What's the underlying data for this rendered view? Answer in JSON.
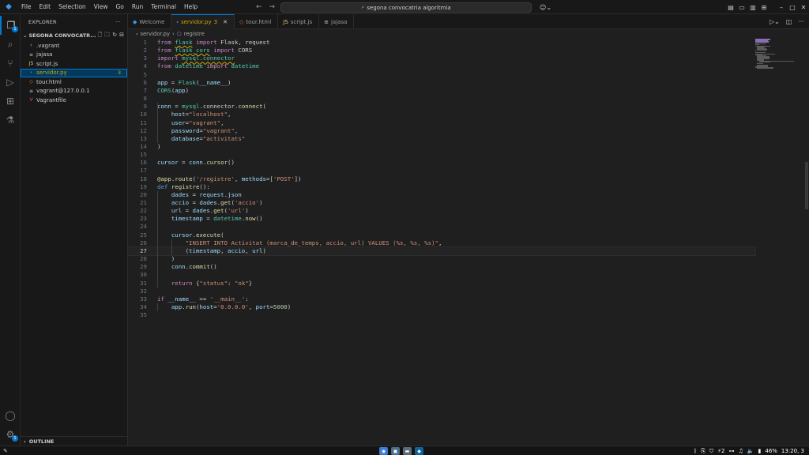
{
  "titlebar": {
    "menu": [
      "File",
      "Edit",
      "Selection",
      "View",
      "Go",
      "Run",
      "Terminal",
      "Help"
    ],
    "search_text": "segona convocatria algoritmia"
  },
  "activity": {
    "explorer_badge": "1",
    "settings_badge": "1"
  },
  "sidebar": {
    "header": "EXPLORER",
    "folder": "SEGONA CONVOCATR...",
    "files": [
      {
        "name": ".vagrant",
        "icon": "chevron-right-icon",
        "glyph": "›",
        "color": "#cccccc"
      },
      {
        "name": "jajasa",
        "icon": "file-icon",
        "glyph": "≡",
        "color": "#cccccc"
      },
      {
        "name": "script.js",
        "icon": "js-icon",
        "glyph": "JS",
        "color": "#e5c07b"
      },
      {
        "name": "servidor.py",
        "icon": "python-icon",
        "glyph": "⬩",
        "color": "#3b8ee0",
        "count": "3"
      },
      {
        "name": "tour.html",
        "icon": "html-icon",
        "glyph": "◇",
        "color": "#e37933"
      },
      {
        "name": "vagrant@127.0.0.1",
        "icon": "file-icon",
        "glyph": "≡",
        "color": "#cccccc"
      },
      {
        "name": "Vagrantfile",
        "icon": "vagrant-icon",
        "glyph": "V",
        "color": "#e05252"
      }
    ],
    "outline": "OUTLINE"
  },
  "tabs": [
    {
      "label": "Welcome",
      "icon": "vscode-icon",
      "glyph": "◆",
      "color": "#3b9be8"
    },
    {
      "label": "servidor.py",
      "icon": "python-icon",
      "glyph": "⬩",
      "color": "#3b8ee0",
      "modified": "3",
      "active": true
    },
    {
      "label": "tour.html",
      "icon": "html-icon",
      "glyph": "◇",
      "color": "#e37933"
    },
    {
      "label": "script.js",
      "icon": "js-icon",
      "glyph": "JS",
      "color": "#e5c07b"
    },
    {
      "label": "jajasa",
      "icon": "file-icon",
      "glyph": "≡",
      "color": "#cccccc"
    }
  ],
  "breadcrumb": {
    "file": "servidor.py",
    "symbol": "registre"
  },
  "editor": {
    "current_line": 27,
    "lines": [
      "[{\"t\":\"from\",\"c\":\"kw\"},{\"t\":\" \"},{\"t\":\"flask\",\"c\":\"mod2\"},{\"t\":\" \"},{\"t\":\"import\",\"c\":\"kw\"},{\"t\":\" Flask, request\"}]",
      "[{\"t\":\"from\",\"c\":\"kw\"},{\"t\":\" \"},{\"t\":\"flask_cors\",\"c\":\"mod2\"},{\"t\":\" \"},{\"t\":\"import\",\"c\":\"kw\"},{\"t\":\" CORS\"}]",
      "[{\"t\":\"import\",\"c\":\"kw\"},{\"t\":\" \"},{\"t\":\"mysql.connector\",\"c\":\"mod2\"}]",
      "[{\"t\":\"from\",\"c\":\"kw\"},{\"t\":\" \"},{\"t\":\"datetime\",\"c\":\"cls\"},{\"t\":\" \"},{\"t\":\"import\",\"c\":\"kw\"},{\"t\":\" \"},{\"t\":\"datetime\",\"c\":\"cls\"}]",
      "[]",
      "[{\"t\":\"app\",\"c\":\"var\"},{\"t\":\" = \"},{\"t\":\"Flask\",\"c\":\"cls\"},{\"t\":\"(\"},{\"t\":\"__name__\",\"c\":\"var\"},{\"t\":\")\"}]",
      "[{\"t\":\"CORS\",\"c\":\"cls\"},{\"t\":\"(\"},{\"t\":\"app\",\"c\":\"var\"},{\"t\":\")\"}]",
      "[]",
      "[{\"t\":\"conn\",\"c\":\"var\"},{\"t\":\" = \"},{\"t\":\"mysql\",\"c\":\"cls\"},{\"t\":\".connector.\"},{\"t\":\"connect\",\"c\":\"fn\"},{\"t\":\"(\"}]",
      "[{\"t\":\"    \"},{\"t\":\"host\",\"c\":\"var\"},{\"t\":\"=\"},{\"t\":\"\\\"localhost\\\"\",\"c\":\"str\"},{\"t\":\",\"}]",
      "[{\"t\":\"    \"},{\"t\":\"user\",\"c\":\"var\"},{\"t\":\"=\"},{\"t\":\"\\\"vagrant\\\"\",\"c\":\"str\"},{\"t\":\",\"}]",
      "[{\"t\":\"    \"},{\"t\":\"password\",\"c\":\"var\"},{\"t\":\"=\"},{\"t\":\"\\\"vagrant\\\"\",\"c\":\"str\"},{\"t\":\",\"}]",
      "[{\"t\":\"    \"},{\"t\":\"database\",\"c\":\"var\"},{\"t\":\"=\"},{\"t\":\"\\\"activitats\\\"\",\"c\":\"str\"}]",
      "[{\"t\":\")\"}]",
      "[]",
      "[{\"t\":\"cursor\",\"c\":\"var\"},{\"t\":\" = \"},{\"t\":\"conn\",\"c\":\"var\"},{\"t\":\".\"},{\"t\":\"cursor\",\"c\":\"fn\"},{\"t\":\"()\"}]",
      "[]",
      "[{\"t\":\"@\",\"c\":\"fn\"},{\"t\":\"app\",\"c\":\"fn\"},{\"t\":\".\"},{\"t\":\"route\",\"c\":\"fn\"},{\"t\":\"(\"},{\"t\":\"'/registre'\",\"c\":\"str\"},{\"t\":\", \"},{\"t\":\"methods\",\"c\":\"var\"},{\"t\":\"=[\"},{\"t\":\"'POST'\",\"c\":\"str\"},{\"t\":\"])\"}]",
      "[{\"t\":\"def\",\"c\":\"kw2\"},{\"t\":\" \"},{\"t\":\"registre\",\"c\":\"fn\"},{\"t\":\"():\"}]",
      "[{\"t\":\"    \"},{\"t\":\"dades\",\"c\":\"var\"},{\"t\":\" = \"},{\"t\":\"request\",\"c\":\"var\"},{\"t\":\".\"},{\"t\":\"json\",\"c\":\"var\"}]",
      "[{\"t\":\"    \"},{\"t\":\"accio\",\"c\":\"var\"},{\"t\":\" = \"},{\"t\":\"dades\",\"c\":\"var\"},{\"t\":\".\"},{\"t\":\"get\",\"c\":\"fn\"},{\"t\":\"(\"},{\"t\":\"'accio'\",\"c\":\"str\"},{\"t\":\")\"}]",
      "[{\"t\":\"    \"},{\"t\":\"url\",\"c\":\"var\"},{\"t\":\" = \"},{\"t\":\"dades\",\"c\":\"var\"},{\"t\":\".\"},{\"t\":\"get\",\"c\":\"fn\"},{\"t\":\"(\"},{\"t\":\"'url'\",\"c\":\"str\"},{\"t\":\")\"}]",
      "[{\"t\":\"    \"},{\"t\":\"timestamp\",\"c\":\"var\"},{\"t\":\" = \"},{\"t\":\"datetime\",\"c\":\"cls\"},{\"t\":\".\"},{\"t\":\"now\",\"c\":\"fn\"},{\"t\":\"()\"}]",
      "[]",
      "[{\"t\":\"    \"},{\"t\":\"cursor\",\"c\":\"var\"},{\"t\":\".\"},{\"t\":\"execute\",\"c\":\"fn\"},{\"t\":\"(\"}]",
      "[{\"t\":\"        \"},{\"t\":\"\\\"INSERT INTO Activitat (marca_de_temps, accio, url) VALUES (%s, %s, %s)\\\"\",\"c\":\"str\"},{\"t\":\",\"}]",
      "[{\"t\":\"        (\"},{\"t\":\"timestamp\",\"c\":\"var\"},{\"t\":\", \"},{\"t\":\"accio\",\"c\":\"var\"},{\"t\":\", \"},{\"t\":\"url\",\"c\":\"var\"},{\"t\":\")\"}]",
      "[{\"t\":\"    )\"}]",
      "[{\"t\":\"    \"},{\"t\":\"conn\",\"c\":\"var\"},{\"t\":\".\"},{\"t\":\"commit\",\"c\":\"fn\"},{\"t\":\"()\"}]",
      "[]",
      "[{\"t\":\"    \"},{\"t\":\"return\",\"c\":\"kw\"},{\"t\":\" {\"},{\"t\":\"\\\"status\\\"\",\"c\":\"str\"},{\"t\":\": \"},{\"t\":\"\\\"ok\\\"\",\"c\":\"str\"},{\"t\":\"}\"}]",
      "[]",
      "[{\"t\":\"if\",\"c\":\"kw\"},{\"t\":\" \"},{\"t\":\"__name__\",\"c\":\"var\"},{\"t\":\" == \"},{\"t\":\"'__main__'\",\"c\":\"str\"},{\"t\":\":\"}]",
      "[{\"t\":\"    \"},{\"t\":\"app\",\"c\":\"var\"},{\"t\":\".\"},{\"t\":\"run\",\"c\":\"fn\"},{\"t\":\"(\"},{\"t\":\"host\",\"c\":\"var\"},{\"t\":\"=\"},{\"t\":\"'0.0.0.0'\",\"c\":\"str\"},{\"t\":\", \"},{\"t\":\"port\",\"c\":\"var\"},{\"t\":\"=\"},{\"t\":\"5000\",\"c\":\"num\"},{\"t\":\")\"}]",
      "[]"
    ]
  },
  "taskbar": {
    "battery": "46%",
    "clock": "13:20, 3",
    "network_count": "2"
  }
}
